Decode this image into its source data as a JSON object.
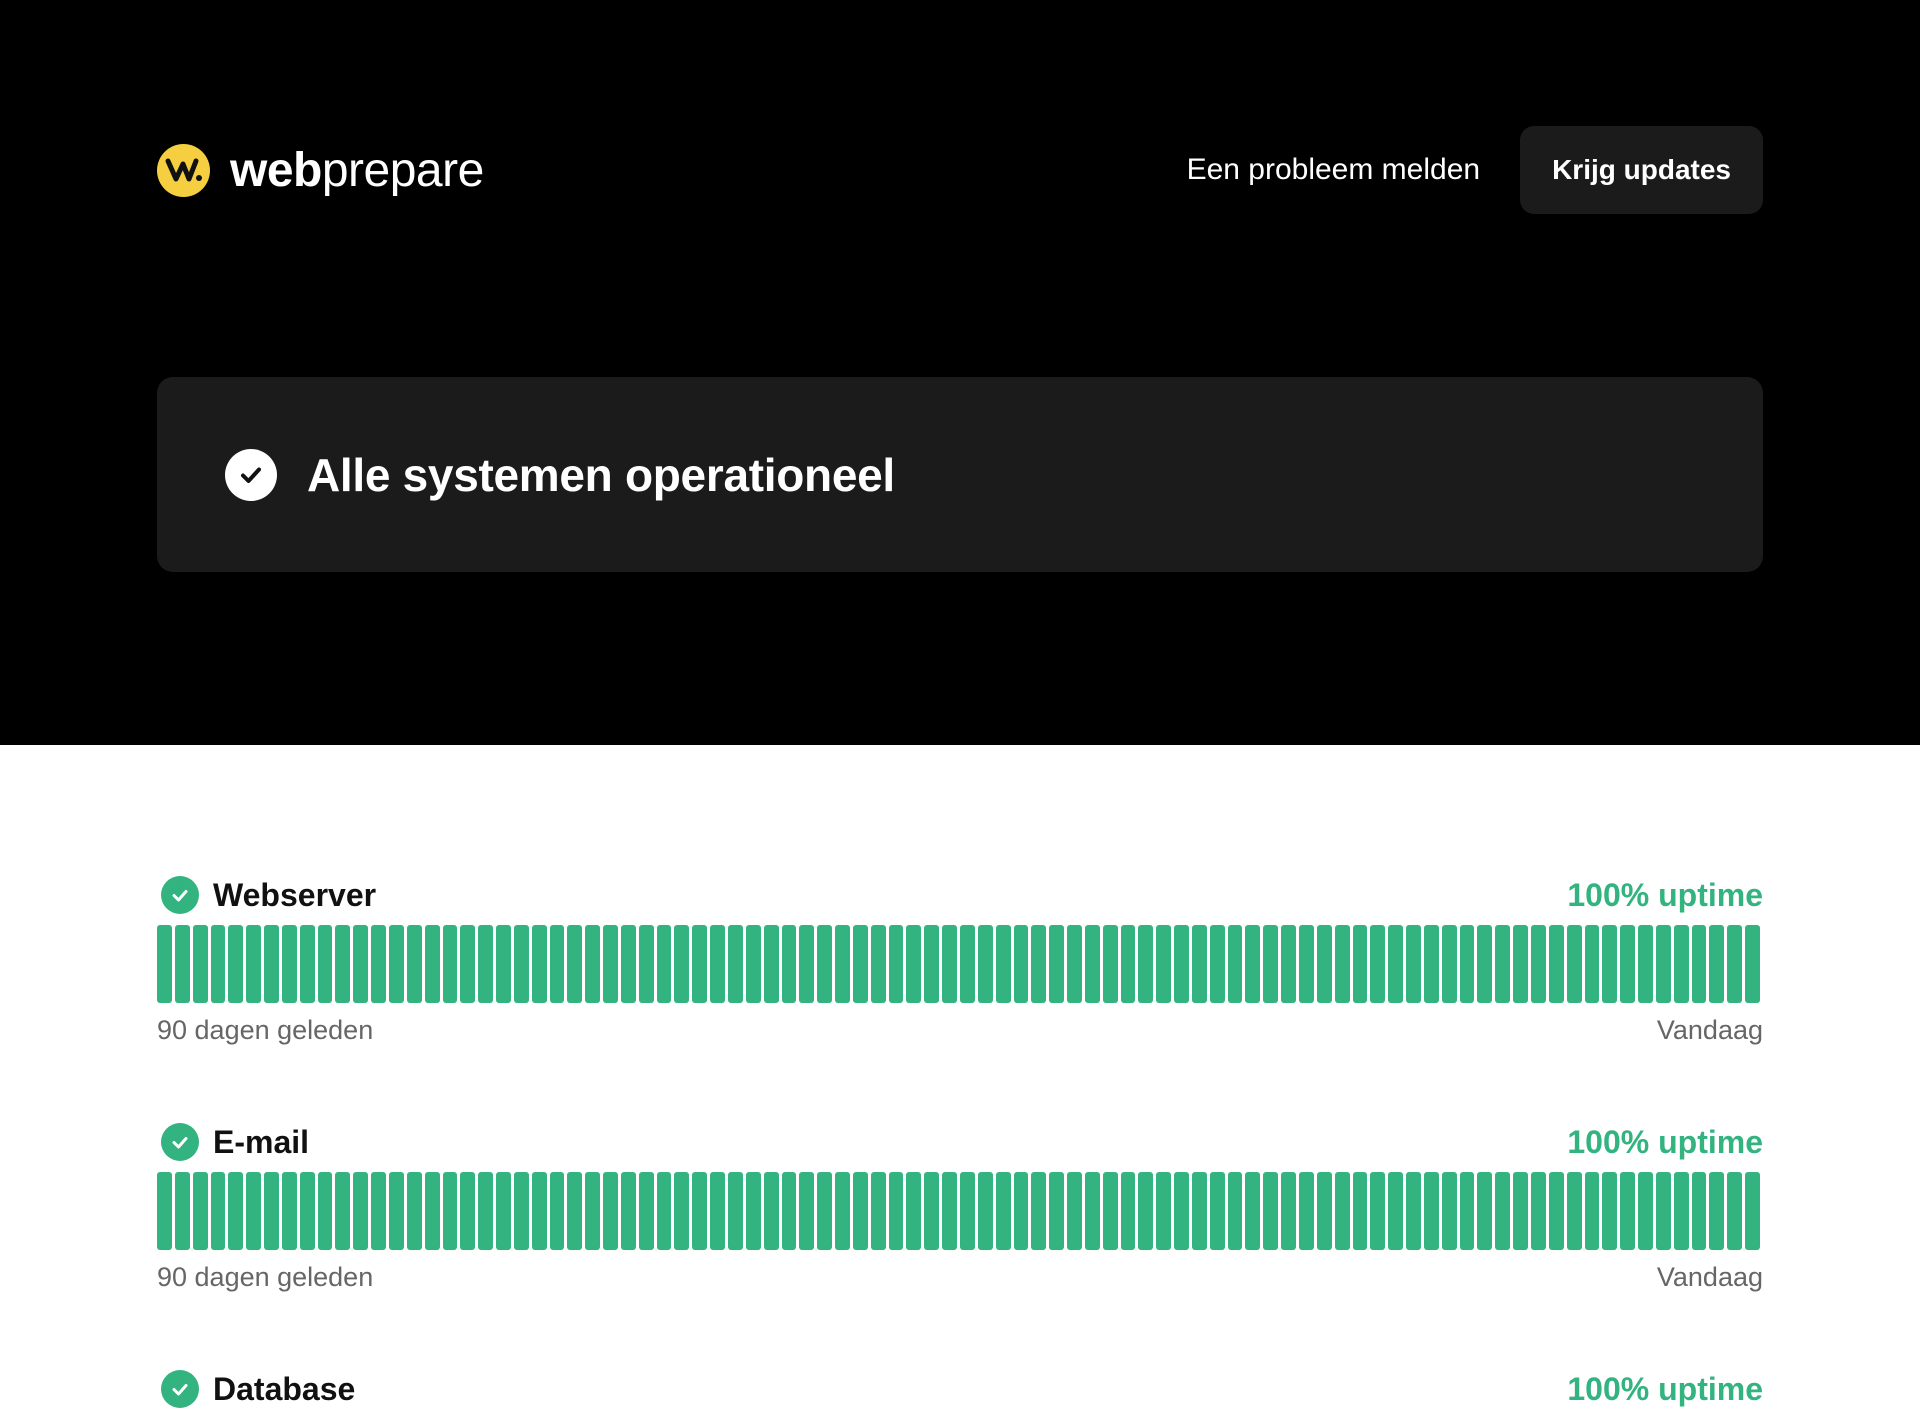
{
  "brand": {
    "name_bold": "web",
    "name_light": "prepare",
    "logo_icon": "webprepare-logo-icon",
    "accent_color": "#f5cf3f"
  },
  "nav": {
    "report_link": "Een probleem melden",
    "updates_button": "Krijg updates"
  },
  "status": {
    "title": "Alle systemen operationeel",
    "icon": "check-circle-icon"
  },
  "colors": {
    "operational": "#33b37f",
    "hero_bg": "#000000",
    "card_bg": "#1b1b1b"
  },
  "components": [
    {
      "name": "Webserver",
      "uptime": "100% uptime",
      "start_label": "90 dagen geleden",
      "end_label": "Vandaag",
      "days": 90,
      "status": "operational"
    },
    {
      "name": "E-mail",
      "uptime": "100% uptime",
      "start_label": "90 dagen geleden",
      "end_label": "Vandaag",
      "days": 90,
      "status": "operational"
    },
    {
      "name": "Database",
      "uptime": "100% uptime",
      "status": "operational"
    }
  ]
}
